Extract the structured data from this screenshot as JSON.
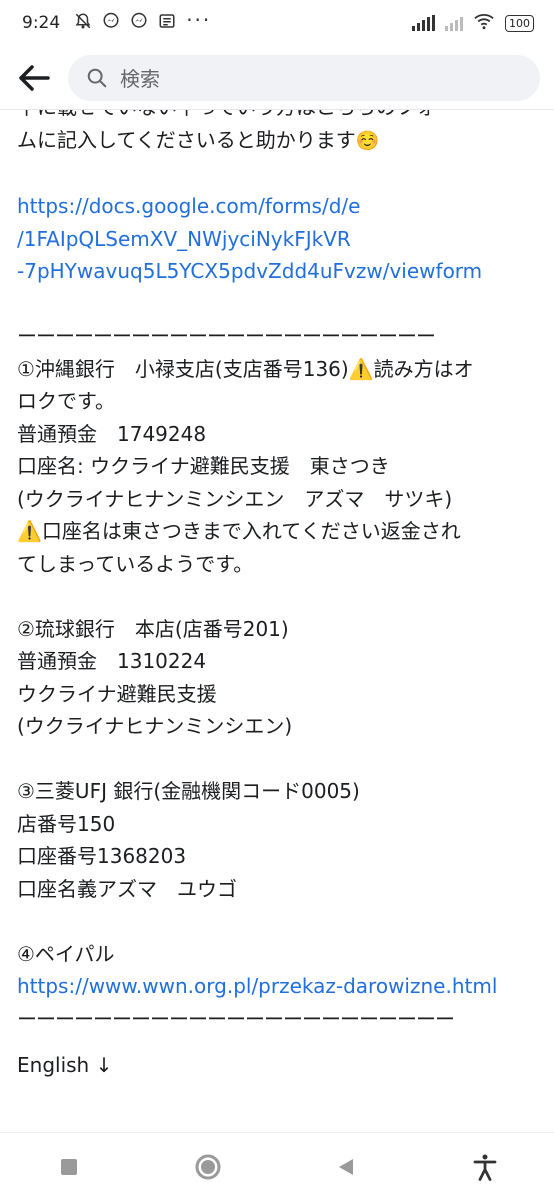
{
  "status_bar": {
    "time": "9:24",
    "battery": "100"
  },
  "search": {
    "placeholder": "検索"
  },
  "post": {
    "cut_top_line": "下に載せていない下っていう方はこちらのフォ",
    "intro_line": "ムに記入してくださいると助かります",
    "intro_emoji": "☺️",
    "form_link": "https://docs.google.com/forms/d/e/1FAIpQLSemXV_NWjyciNykFJkVR-7pHYwavuq5L5YCX5pdvZdd4uFvzw/viewform",
    "form_link_lines": [
      "https://docs.google.com/forms/d/e",
      "/1FAIpQLSemXV_NWjyciNykFJkVR",
      "-7pHYwavuq5L5YCX5pdvZdd4uFvzw/viewform"
    ],
    "divider": "ーーーーーーーーーーーーーーーーーーーーーー",
    "bank1": {
      "title_a": "①沖縄銀行　小禄支店(支店番号136)",
      "warn_icon": "⚠️",
      "title_b": "読み方はオ",
      "title_c": "ロクです。",
      "account": "普通預金　1749248",
      "name": "口座名: ウクライナ避難民支援　東さつき",
      "kana": "(ウクライナヒナンミンシエン　アズマ　サツキ)",
      "warn2_a": "口座名は東さつきまで入れてください返金され",
      "warn2_b": "てしまっているようです。"
    },
    "bank2": {
      "title": "②琉球銀行　本店(店番号201)",
      "account": "普通預金　1310224",
      "name": "ウクライナ避難民支援",
      "kana": "(ウクライナヒナンミンシエン)"
    },
    "bank3": {
      "title": "③三菱UFJ 銀行(金融機関コード0005)",
      "branch": "店番号150",
      "account": "口座番号1368203",
      "name": "口座名義アズマ　ユウゴ"
    },
    "paypal": {
      "title": "④ペイパル",
      "link": "https://www.wwn.org.pl/przekaz-darowizne.html"
    },
    "divider2": "ーーーーーーーーーーーーーーーーーーーーーーー",
    "english_label": "English ↓"
  },
  "colors": {
    "link": "#216fdb",
    "text": "#1c1e21",
    "search_bg": "#f0f2f5"
  },
  "icons": [
    "bell-off-icon",
    "messenger-icon",
    "messenger-icon",
    "news-icon",
    "more-icon",
    "signal-icon",
    "wifi-icon",
    "battery-icon",
    "back-arrow-icon",
    "search-icon",
    "nav-square-icon",
    "nav-circle-icon",
    "nav-back-triangle-icon",
    "accessibility-icon"
  ]
}
